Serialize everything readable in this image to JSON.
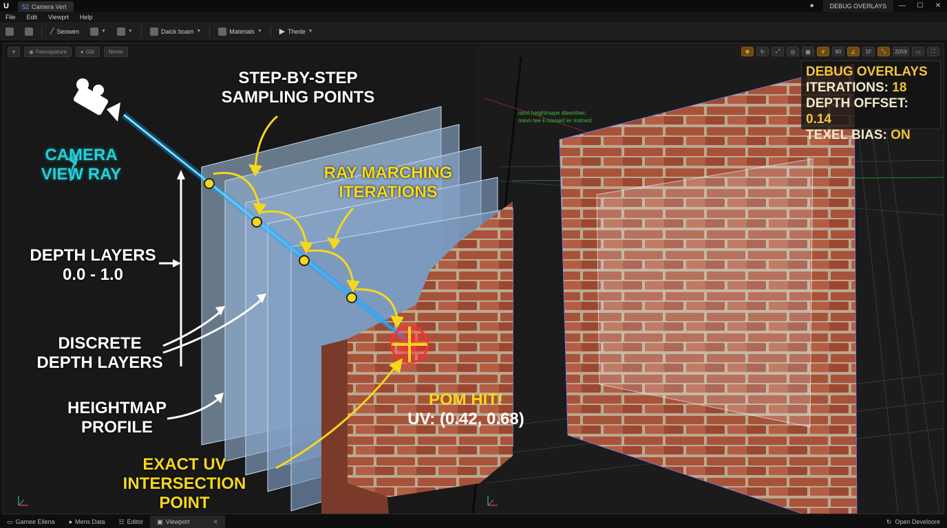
{
  "titlebar": {
    "logo": "U",
    "doc_tab": "Camera Vert",
    "doc_tab_badge": "52",
    "debug_label": "DEBUG OVERLAYS",
    "minimize": "—",
    "maximize": "☐",
    "close": "✕"
  },
  "menu": [
    "File",
    "Edit",
    "Viewprt",
    "Help"
  ],
  "toolbar": {
    "b1": "Seowen",
    "b2": "Daick boam",
    "b3": "Materials",
    "b4": "Thede"
  },
  "viewport_left_controls": {
    "perspective": "Feenspature",
    "lit": "Gtir",
    "show": "Neme"
  },
  "viewport_right_controls": [
    "90",
    "1F",
    "2059"
  ],
  "green_log": [
    "rarot heightmape dteenthec.",
    "mevn tee ii noused ier lnstrent"
  ],
  "debug_overlay": {
    "heading": "DEBUG OVERLAYS",
    "iterations_label": "ITERATIONS:",
    "iterations_value": "18",
    "depth_label": "DEPTH OFFSET:",
    "depth_value": "0.14",
    "texel_label": "TEXEL BIAS:",
    "texel_value": "ON"
  },
  "annotations": {
    "camera_line1": "CAMERA",
    "camera_line2": "VIEW RAY",
    "step_line1": "STEP-BY-STEP",
    "step_line2": "SAMPLING POINTS",
    "ray_line1": "RAY MARCHING",
    "ray_line2": "ITERATIONS",
    "depth_line1": "DEPTH LAYERS",
    "depth_line2": "0.0 - 1.0",
    "discrete_line1": "DISCRETE",
    "discrete_line2": "DEPTH LAYERS",
    "height_line1": "HEIGHTMAP",
    "height_line2": "PROFILE",
    "exact_line1": "EXACT UV",
    "exact_line2": "INTERSECTION POINT",
    "pom_hit": "POM HIT!",
    "uv": "UV: (0.42, 0.68)"
  },
  "bottom_tabs": [
    "Gamee Eilena",
    "Mens Data",
    "Editor",
    "Viewport"
  ],
  "bottom_right": "Open Develoore",
  "colors": {
    "accent_yellow": "#f5d81c",
    "accent_cyan": "#27d0d8",
    "brick": "#a8523a",
    "mortar": "#b9a990"
  }
}
